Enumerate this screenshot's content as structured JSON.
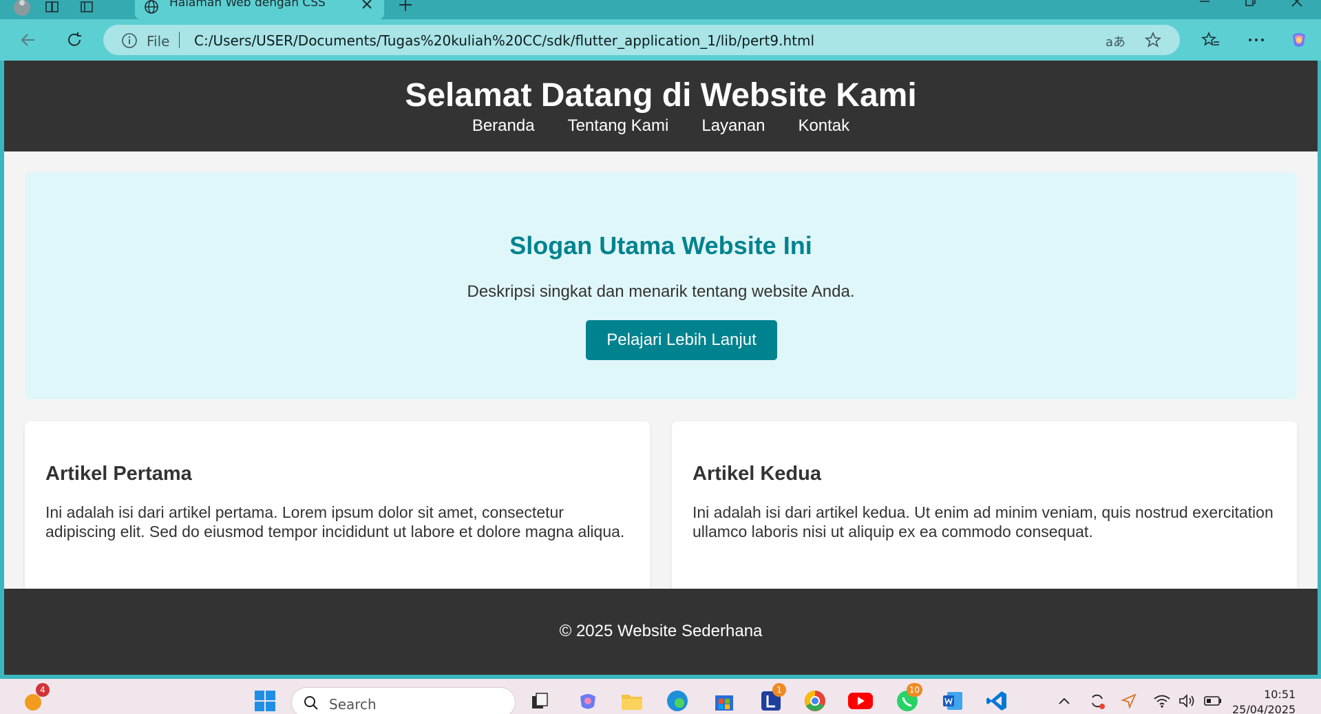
{
  "browser": {
    "tab_title": "Halaman Web dengan CSS",
    "protocol_label": "File",
    "url": "C:/Users/USER/Documents/Tugas%20kuliah%20CC/sdk/flutter_application_1/lib/pert9.html",
    "read_aloud_label": "aあ",
    "accent_color": "#5ccfd2"
  },
  "page": {
    "header_title": "Selamat Datang di Website Kami",
    "nav": [
      "Beranda",
      "Tentang Kami",
      "Layanan",
      "Kontak"
    ],
    "hero": {
      "title": "Slogan Utama Website Ini",
      "description": "Deskripsi singkat dan menarik tentang website Anda.",
      "button_label": "Pelajari Lebih Lanjut"
    },
    "articles": [
      {
        "title": "Artikel Pertama",
        "body": "Ini adalah isi dari artikel pertama. Lorem ipsum dolor sit amet, consectetur adipiscing elit. Sed do eiusmod tempor incididunt ut labore et dolore magna aliqua."
      },
      {
        "title": "Artikel Kedua",
        "body": "Ini adalah isi dari artikel kedua. Ut enim ad minim veniam, quis nostrud exercitation ullamco laboris nisi ut aliquip ex ea commodo consequat."
      }
    ],
    "footer": "© 2025 Website Sederhana",
    "colors": {
      "dark": "#333333",
      "teal": "#00838f",
      "hero_bg": "#e0f7fa"
    }
  },
  "taskbar": {
    "search_label": "Search",
    "weather_badge": "4",
    "lens_badge": "1",
    "whatsapp_badge": "10",
    "time": "10:51",
    "date": "25/04/2025"
  }
}
